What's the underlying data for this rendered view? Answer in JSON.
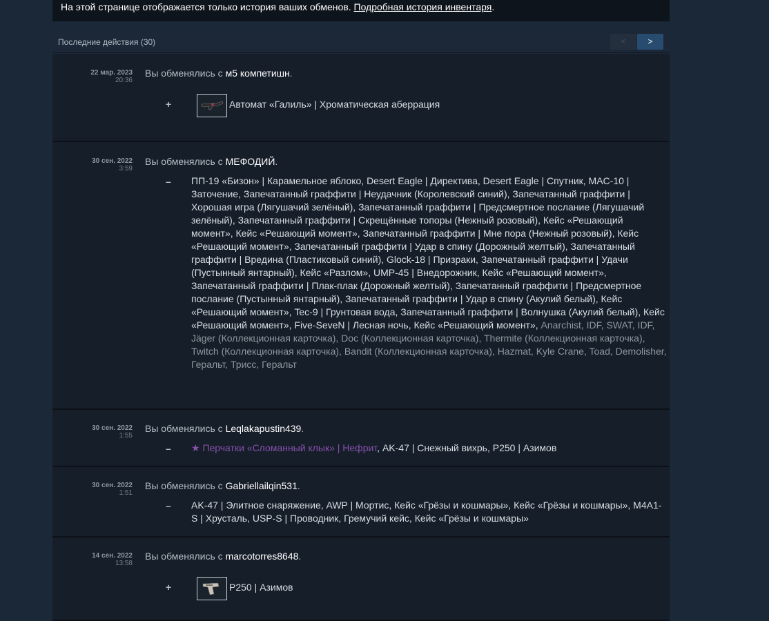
{
  "notice": {
    "text": "На этой странице отображается только история ваших обменов. ",
    "link": "Подробная история инвентаря",
    "tail": "."
  },
  "bar": {
    "title": "Последние действия (30)",
    "prev": "<",
    "next": ">"
  },
  "common": {
    "trade_prefix": "Вы обменялись с ",
    "dot": "."
  },
  "trades": [
    {
      "date": "22 мар. 2023",
      "time": "20:36",
      "partner": "м5 компетишн",
      "sign": "+",
      "item": "Автомат «Галиль» | Хроматическая аберрация"
    },
    {
      "date": "30 сен. 2022",
      "time": "3:59",
      "partner": "МЕФОДИЙ",
      "sign": "–",
      "items_white": "ПП-19 «Бизон» | Карамельное яблоко, Desert Eagle | Директива, Desert Eagle | Спутник, MAC-10 | Заточение, Запечатанный граффити | Неудачник (Королевский синий), Запечатанный граффити | Хорошая игра (Лягушачий зелёный), Запечатанный граффити | Предсмертное послание (Лягушачий зелёный), Запечатанный граффити | Скрещённые топоры (Нежный розовый), Кейс «Решающий момент», Кейс «Решающий момент», Запечатанный граффити | Мне пора (Нежный розовый), Кейс «Решающий момент», Запечатанный граффити | Удар в спину (Дорожный желтый), Запечатанный граффити | Вредина (Пластиковый синий), Glock-18 | Призраки, Запечатанный граффити | Удачи (Пустынный янтарный), Кейс «Разлом», UMP-45 | Внедорожник, Кейс «Решающий момент», Запечатанный граффити | Плак-плак (Дорожный желтый), Запечатанный граффити | Предсмертное послание (Пустынный янтарный), Запечатанный граффити | Удар в спину (Акулий белый), Кейс «Решающий момент», Tec-9 | Грунтовая вода, Запечатанный граффити | Волнушка (Акулий белый), Кейс «Решающий момент», Five-SeveN | Лесная ночь, Кейс «Решающий момент»,",
      "items_gray": " Anarchist, IDF, SWAT, IDF, Jäger (Коллекционная карточка), Doc (Коллекционная карточка), Thermite (Коллекционная карточка), Twitch (Коллекционная карточка), Bandit (Коллекционная карточка), Hazmat, Kyle Crane, Toad, Demolisher, Геральт, Трисс, Геральт"
    },
    {
      "date": "30 сен. 2022",
      "time": "1:55",
      "partner": "Leqlakapustin439",
      "sign": "–",
      "items_purple": "★ Перчатки «Сломанный клык» | Нефрит",
      "items_white": ", AK-47 | Снежный вихрь, P250 | Азимов"
    },
    {
      "date": "30 сен. 2022",
      "time": "1:51",
      "partner": "Gabriellailqin531",
      "sign": "–",
      "items_white": "AK-47 | Элитное снаряжение, AWP | Мортис, Кейс «Грёзы и кошмары», Кейс «Грёзы и кошмары», M4A1-S | Хрусталь, USP-S | Проводник, Гремучий кейс, Кейс «Грёзы и кошмары»"
    },
    {
      "date": "14 сен. 2022",
      "time": "13:58",
      "partner": "marcotorres8648",
      "sign": "+",
      "item": "P250 | Азимов"
    }
  ]
}
